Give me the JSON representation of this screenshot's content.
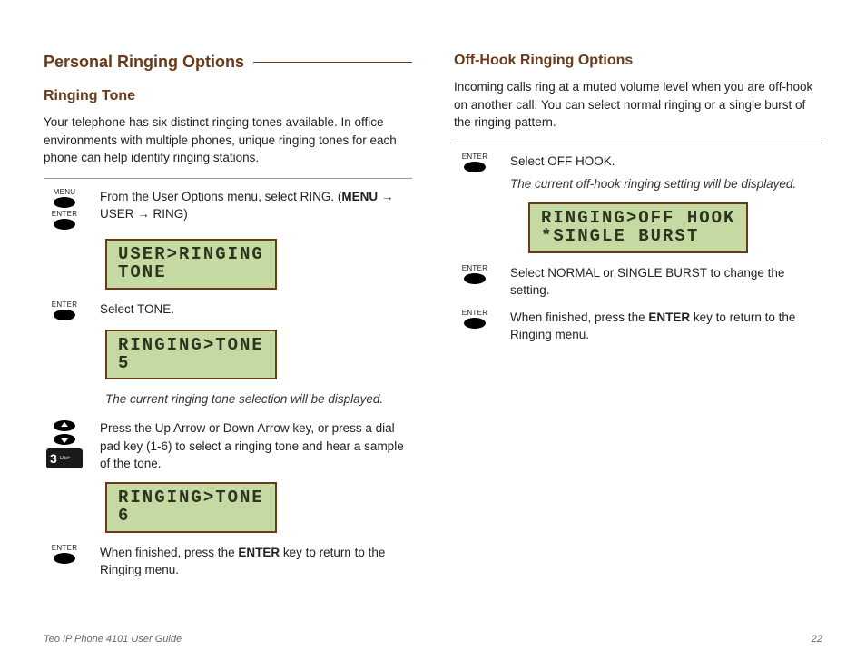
{
  "left": {
    "section_title": "Personal Ringing Options",
    "sub_title": "Ringing Tone",
    "intro": "Your telephone has six distinct ringing tones available. In office environments with multiple phones, unique ringing tones for each phone can help identify ringing stations.",
    "step1_a": "From the User Options menu, select RING. (",
    "step1_b": "MENU",
    "step1_c": " → USER → RING)",
    "lcd1": "USER>RINGING\nTONE",
    "step2": "Select TONE.",
    "lcd2": "RINGING>TONE\n5",
    "note2": "The current ringing tone selection will be displayed.",
    "step3": "Press the Up Arrow or Down Arrow key, or press a dial pad key (1-6) to select a ringing tone and hear a sample of the tone.",
    "lcd3": "RINGING>TONE\n6",
    "step4_a": "When finished, press the ",
    "step4_b": "ENTER",
    "step4_c": " key to return to the Ringing menu.",
    "btn_menu": "MENU",
    "btn_enter": "ENTER",
    "dial_num": "3",
    "dial_let": "DEF"
  },
  "right": {
    "sub_title": "Off-Hook Ringing Options",
    "intro": "Incoming calls ring at a muted volume level when you are off-hook on another call. You can select normal ringing or a single burst of the ringing pattern.",
    "step1": "Select OFF HOOK.",
    "note1": "The current off-hook ringing setting will be displayed.",
    "lcd1": "RINGING>OFF HOOK\n*SINGLE BURST",
    "step2": "Select NORMAL or SINGLE BURST to change the setting.",
    "step3_a": "When finished, press the ",
    "step3_b": "ENTER",
    "step3_c": " key to return to the Ringing menu.",
    "btn_enter": "ENTER"
  },
  "footer": {
    "title": "Teo IP Phone 4101 User Guide",
    "page": "22"
  }
}
